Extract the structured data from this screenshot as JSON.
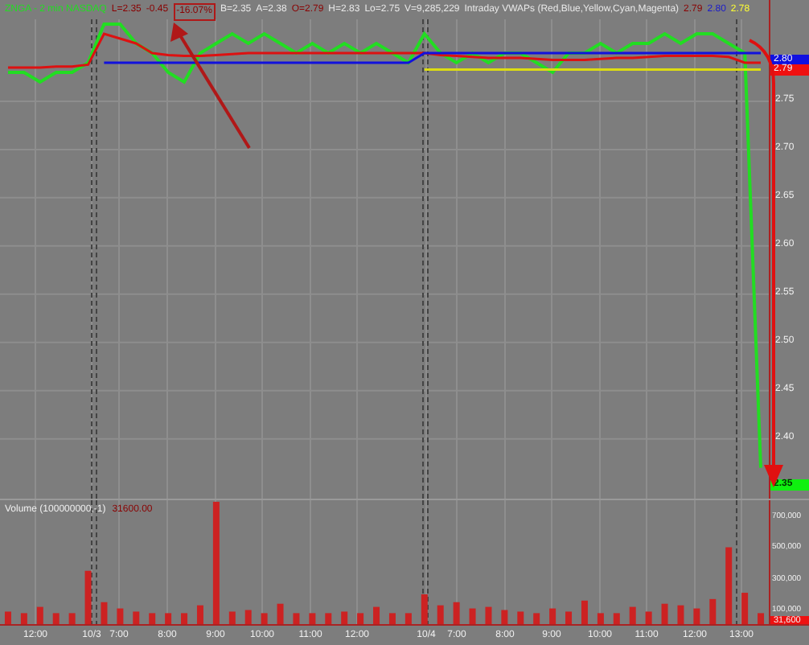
{
  "header": [
    {
      "text": "ZNGA - 2 min  NASDAQ",
      "color": "#22dd22",
      "highlighted": false
    },
    {
      "text": "L=2.35",
      "color": "#8a0000",
      "highlighted": false
    },
    {
      "text": "-0.45",
      "color": "#8a0000",
      "highlighted": false
    },
    {
      "text": "-16.07%",
      "color": "#8a0000",
      "highlighted": true
    },
    {
      "text": "B=2.35",
      "color": "#e8e8e8",
      "highlighted": false
    },
    {
      "text": "A=2.38",
      "color": "#e8e8e8",
      "highlighted": false
    },
    {
      "text": "O=2.79",
      "color": "#8a0000",
      "highlighted": false
    },
    {
      "text": "H=2.83",
      "color": "#e8e8e8",
      "highlighted": false
    },
    {
      "text": "Lo=2.75",
      "color": "#e8e8e8",
      "highlighted": false
    },
    {
      "text": "V=9,285,229",
      "color": "#e8e8e8",
      "highlighted": false
    },
    {
      "text": "Intraday VWAPs (Red,Blue,Yellow,Cyan,Magenta)",
      "color": "#e8e8e8",
      "highlighted": false
    },
    {
      "text": "2.79",
      "color": "#8a0000",
      "highlighted": false
    },
    {
      "text": "2.80",
      "color": "#1a1acc",
      "highlighted": false
    },
    {
      "text": "2.78",
      "color": "#ffff33",
      "highlighted": false
    }
  ],
  "price_axis_badges": [
    {
      "text": "2.80",
      "color": "#1010e0"
    },
    {
      "text": "2.79",
      "color": "#f01010"
    },
    {
      "text": "2.35",
      "color": "#10f010"
    }
  ],
  "price_chart": {
    "chart_data": {
      "type": "line",
      "grid": true,
      "ylim": [
        2.338,
        2.855
      ],
      "categories": [
        null,
        null,
        null,
        null,
        null,
        null,
        null,
        null,
        null,
        null,
        null,
        null,
        null,
        null,
        null,
        null,
        null,
        null,
        null,
        null,
        null,
        null,
        null,
        null,
        null,
        null,
        null,
        null,
        null,
        null,
        null,
        null,
        null,
        null,
        null,
        null,
        null,
        null,
        null,
        null,
        null,
        null,
        null,
        null,
        null,
        null,
        null,
        null
      ],
      "yticks": [
        {
          "value": 2.75,
          "label": "2.75"
        },
        {
          "value": 2.7,
          "label": "2.70"
        },
        {
          "value": 2.65,
          "label": "2.65"
        },
        {
          "value": 2.6,
          "label": "2.60"
        },
        {
          "value": 2.55,
          "label": "2.55"
        },
        {
          "value": 2.5,
          "label": "2.50"
        },
        {
          "value": 2.45,
          "label": "2.45"
        },
        {
          "value": 2.4,
          "label": "2.40"
        }
      ],
      "series": [
        {
          "color": "#22dd22",
          "values": [
            2.78,
            2.78,
            2.77,
            2.78,
            2.78,
            2.79,
            2.83,
            2.83,
            2.81,
            2.8,
            2.78,
            2.77,
            2.8,
            2.81,
            2.82,
            2.81,
            2.82,
            2.81,
            2.8,
            2.81,
            2.8,
            2.81,
            2.8,
            2.81,
            2.8,
            2.79,
            2.82,
            2.8,
            2.79,
            2.8,
            2.79,
            2.8,
            2.8,
            2.79,
            2.78,
            2.8,
            2.8,
            2.81,
            2.8,
            2.81,
            2.81,
            2.82,
            2.81,
            2.82,
            2.82,
            2.81,
            2.8,
            2.37
          ]
        },
        {
          "color": "#dd1111",
          "values": [
            2.785,
            2.785,
            2.785,
            2.786,
            2.786,
            2.788,
            2.82,
            2.815,
            2.81,
            2.8,
            2.798,
            2.797,
            2.797,
            2.798,
            2.799,
            2.8,
            2.8,
            2.8,
            2.8,
            2.8,
            2.8,
            2.8,
            2.8,
            2.8,
            2.8,
            2.8,
            2.8,
            2.798,
            2.797,
            2.796,
            2.795,
            2.795,
            2.795,
            2.794,
            2.793,
            2.793,
            2.793,
            2.794,
            2.795,
            2.795,
            2.796,
            2.797,
            2.797,
            2.797,
            2.797,
            2.796,
            2.79,
            2.79
          ]
        },
        {
          "color": "#1111dd",
          "values": [
            null,
            null,
            null,
            null,
            null,
            null,
            2.79,
            2.79,
            2.79,
            2.79,
            2.79,
            2.79,
            2.79,
            2.79,
            2.79,
            2.79,
            2.79,
            2.79,
            2.79,
            2.79,
            2.79,
            2.79,
            2.79,
            2.79,
            2.79,
            2.79,
            2.8,
            2.8,
            2.8,
            2.8,
            2.8,
            2.8,
            2.8,
            2.8,
            2.8,
            2.8,
            2.8,
            2.8,
            2.8,
            2.8,
            2.8,
            2.8,
            2.8,
            2.8,
            2.8,
            2.8,
            2.8,
            2.8
          ]
        },
        {
          "color": "#dddd11",
          "values": [
            null,
            null,
            null,
            null,
            null,
            null,
            null,
            null,
            null,
            null,
            null,
            null,
            null,
            null,
            null,
            null,
            null,
            null,
            null,
            null,
            null,
            null,
            null,
            null,
            null,
            null,
            2.783,
            2.783,
            2.783,
            2.783,
            2.783,
            2.783,
            2.783,
            2.783,
            2.783,
            2.783,
            2.783,
            2.783,
            2.783,
            2.783,
            2.783,
            2.783,
            2.783,
            2.783,
            2.783,
            2.783,
            2.783,
            2.783
          ]
        }
      ]
    }
  },
  "volume_label": {
    "text": "Volume (100000000,-1)",
    "reading": "31600.00"
  },
  "volume_chart": {
    "chart_data": {
      "type": "bar",
      "grid": true,
      "ylim": [
        0,
        800000
      ],
      "categories": [
        null,
        null,
        null,
        null,
        null,
        null,
        null,
        null,
        null,
        null,
        null,
        null,
        null,
        null,
        null,
        null,
        null,
        null,
        null,
        null,
        null,
        null,
        null,
        null,
        null,
        null,
        null,
        null,
        null,
        null,
        null,
        null,
        null,
        null,
        null,
        null,
        null,
        null,
        null,
        null,
        null,
        null,
        null,
        null,
        null,
        null,
        null,
        null
      ],
      "yticks": [
        {
          "value": 700000,
          "label": "700,000"
        },
        {
          "value": 500000,
          "label": "500,000"
        },
        {
          "value": 300000,
          "label": "300,000"
        },
        {
          "value": 100000,
          "label": "100,000"
        }
      ],
      "series": [
        {
          "color": "#cc2222",
          "values": [
            90000,
            80000,
            120000,
            80000,
            80000,
            350000,
            150000,
            110000,
            90000,
            80000,
            80000,
            80000,
            130000,
            790000,
            90000,
            100000,
            80000,
            140000,
            80000,
            80000,
            80000,
            90000,
            80000,
            120000,
            80000,
            80000,
            200000,
            130000,
            150000,
            110000,
            120000,
            100000,
            90000,
            80000,
            110000,
            90000,
            160000,
            80000,
            80000,
            120000,
            90000,
            140000,
            130000,
            110000,
            170000,
            500000,
            210000,
            80000
          ]
        }
      ]
    }
  },
  "volume_axis_badge": {
    "text": "31,600",
    "color": "#ee1111"
  },
  "time_labels": [
    "12:00",
    "10/3",
    "7:00",
    "8:00",
    "9:00",
    "10:00",
    "11:00",
    "12:00",
    "10/4",
    "7:00",
    "8:00",
    "9:00",
    "10:00",
    "11:00",
    "12:00",
    "13:00"
  ]
}
